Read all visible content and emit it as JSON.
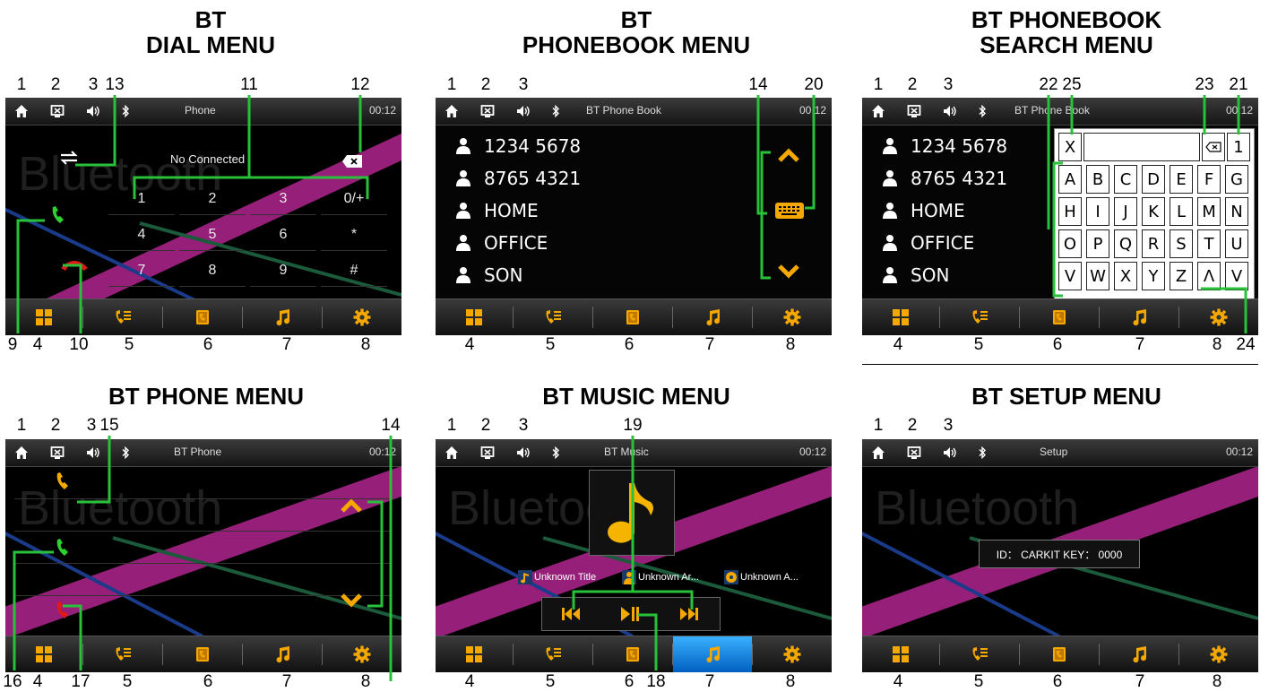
{
  "titles": {
    "dial_l1": "BT",
    "dial_l2": "DIAL MENU",
    "pb_l1": "BT",
    "pb_l2": "PHONEBOOK MENU",
    "pbs_l1": "BT PHONEBOOK",
    "pbs_l2": "SEARCH MENU",
    "phone": "BT PHONE MENU",
    "music": "BT MUSIC MENU",
    "setup": "BT SETUP MENU"
  },
  "screens": {
    "dial": {
      "title": "Phone",
      "time": "00:12",
      "status": "No Connected",
      "watermark": "Bluetooth",
      "keys": [
        "1",
        "2",
        "3",
        "0/+",
        "4",
        "5",
        "6",
        "*",
        "7",
        "8",
        "9",
        "#"
      ]
    },
    "phonebook": {
      "title": "BT Phone Book",
      "time": "00:12",
      "contacts": [
        "1234 5678",
        "8765 4321",
        "HOME",
        "OFFICE",
        "SON"
      ]
    },
    "search": {
      "title": "BT Phone Book",
      "time": "00:12",
      "contacts": [
        "1234 5678",
        "8765 4321",
        "HOME",
        "OFFICE",
        "SON"
      ],
      "clear_key": "X",
      "number_key": "1",
      "letters": [
        "A",
        "B",
        "C",
        "D",
        "E",
        "F",
        "G",
        "H",
        "I",
        "J",
        "K",
        "L",
        "M",
        "N",
        "O",
        "P",
        "Q",
        "R",
        "S",
        "T",
        "U",
        "V",
        "W",
        "X",
        "Y",
        "Z",
        "Λ",
        "V"
      ]
    },
    "phone": {
      "title": "BT Phone",
      "time": "00:12",
      "watermark": "Bluetooth"
    },
    "music": {
      "title": "BT Music",
      "time": "00:12",
      "watermark": "Bluetooth",
      "track_title": "Unknown Title",
      "artist": "Unknown Ar...",
      "album": "Unknown A..."
    },
    "setup": {
      "title": "Setup",
      "time": "00:12",
      "watermark": "Bluetooth",
      "id_text": "ID： CARKIT  KEY： 0000"
    }
  },
  "callouts": {
    "dial_top": [
      "1",
      "2",
      "3",
      "13",
      "11",
      "12"
    ],
    "dial_bottom": [
      "9",
      "4",
      "10",
      "5",
      "6",
      "7",
      "8"
    ],
    "pb_top": [
      "1",
      "2",
      "3",
      "14",
      "20"
    ],
    "pb_bottom": [
      "4",
      "5",
      "6",
      "7",
      "8"
    ],
    "pbs_top": [
      "1",
      "2",
      "3",
      "22",
      "25",
      "23",
      "21"
    ],
    "pbs_bottom": [
      "4",
      "5",
      "6",
      "7",
      "8",
      "24"
    ],
    "phone_top": [
      "1",
      "2",
      "3",
      "15",
      "14"
    ],
    "phone_bottom": [
      "16",
      "4",
      "17",
      "5",
      "6",
      "7",
      "8"
    ],
    "music_top": [
      "1",
      "2",
      "3",
      "19"
    ],
    "music_bottom": [
      "4",
      "5",
      "6",
      "18",
      "7",
      "8"
    ],
    "setup_top": [
      "1",
      "2",
      "3"
    ],
    "setup_bottom": [
      "4",
      "5",
      "6",
      "7",
      "8"
    ]
  },
  "icons": {
    "status_bar": [
      "home-icon",
      "screen-off-icon",
      "volume-icon",
      "bluetooth-icon"
    ],
    "bottom_bar": [
      "menu-grid-icon",
      "call-log-icon",
      "phonebook-icon",
      "music-note-icon",
      "settings-gear-icon"
    ]
  },
  "colors": {
    "accent": "#f5a800",
    "callout": "#27c23a",
    "answer": "#2fd12f",
    "hangup": "#e01818",
    "active_tab": "#1e90ff"
  }
}
